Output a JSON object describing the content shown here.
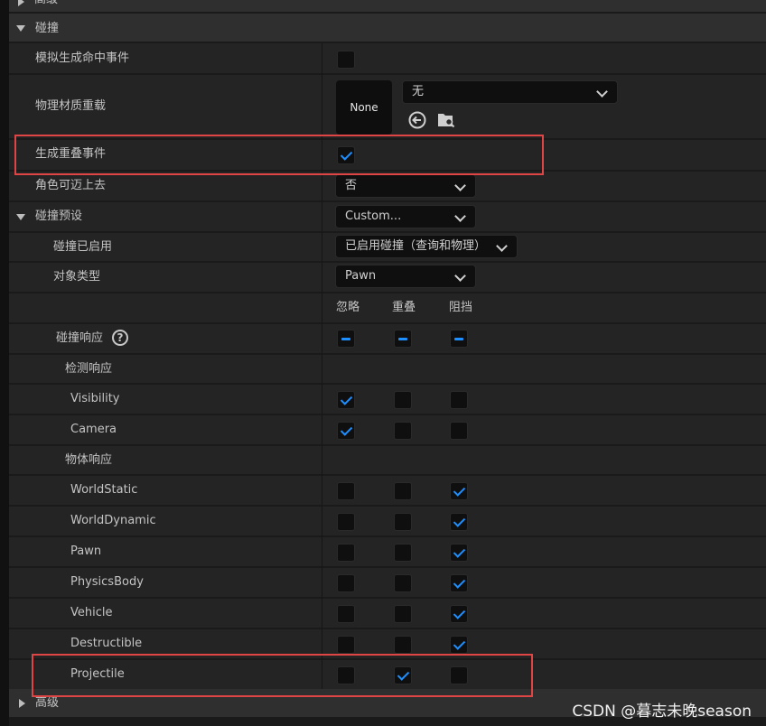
{
  "top_partial_label": "高级",
  "collision_section": {
    "label": "碰撞"
  },
  "rows": {
    "simulate_hit": {
      "label": "模拟生成命中事件",
      "checked": false
    },
    "phys_material": {
      "label": "物理材质重载",
      "thumb_text": "None",
      "dropdown_value": "无",
      "reset_icon": "arrow-left-circle-icon",
      "browse_icon": "folder-search-icon"
    },
    "gen_overlap": {
      "label": "生成重叠事件",
      "checked": true
    },
    "can_step_up": {
      "label": "角色可迈上去",
      "value": "否"
    },
    "collision_presets": {
      "label": "碰撞预设",
      "value": "Custom..."
    },
    "collision_enabled": {
      "label": "碰撞已启用",
      "value": "已启用碰撞（查询和物理）"
    },
    "object_type": {
      "label": "对象类型",
      "value": "Pawn"
    }
  },
  "columns": [
    "忽略",
    "重叠",
    "阻挡"
  ],
  "collision_response": {
    "label": "碰撞响应",
    "help_icon": "question-circle-icon",
    "help_glyph": "?"
  },
  "trace_header": "检测响应",
  "object_header": "物体响应",
  "trace_channels": [
    {
      "label": "Visibility",
      "response": [
        true,
        false,
        false
      ]
    },
    {
      "label": "Camera",
      "response": [
        true,
        false,
        false
      ]
    }
  ],
  "object_channels": [
    {
      "label": "WorldStatic",
      "response": [
        false,
        false,
        true
      ]
    },
    {
      "label": "WorldDynamic",
      "response": [
        false,
        false,
        true
      ]
    },
    {
      "label": "Pawn",
      "response": [
        false,
        false,
        true
      ]
    },
    {
      "label": "PhysicsBody",
      "response": [
        false,
        false,
        true
      ]
    },
    {
      "label": "Vehicle",
      "response": [
        false,
        false,
        true
      ]
    },
    {
      "label": "Destructible",
      "response": [
        false,
        false,
        true
      ]
    },
    {
      "label": "Projectile",
      "response": [
        false,
        true,
        false
      ]
    }
  ],
  "advanced_section": {
    "label": "高级"
  },
  "watermark": "CSDN @暮志未晚season",
  "colors": {
    "accent": "#1e8fff",
    "highlight": "#e04545",
    "row": "#242424",
    "category": "#2f2f2f"
  }
}
